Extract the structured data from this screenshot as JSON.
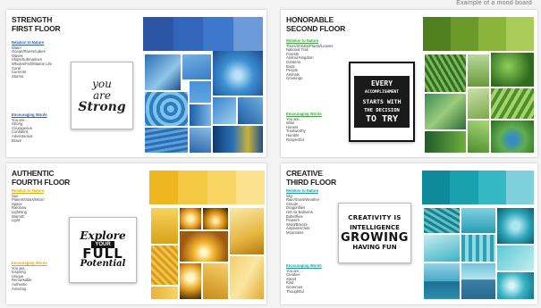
{
  "caption": "Example of a mood board",
  "panels": [
    {
      "title": "STRENGTH\nFIRST FLOOR",
      "section1_heading": "Relation to Nature",
      "section1_color": "#2b5fb8",
      "section1_items": [
        "Water",
        "Ocean/Rivers/Lakes",
        "Waves",
        "Ships/Submarines",
        "Whales/Fish/Marine Life",
        "Coral",
        "Currents",
        "Storms"
      ],
      "section2_heading": "Encouraging Words",
      "section2_color": "#2b5fb8",
      "section2_items": [
        "You are...",
        "Strong",
        "Courageous",
        "Confident",
        "Adventurous",
        "Brave"
      ],
      "quote_lines": [
        "you",
        "are",
        "Strong"
      ],
      "palette": [
        "#2c55a6",
        "#3366bb",
        "#3e78cc",
        "#6c9ad8"
      ]
    },
    {
      "title": "HONORABLE\nSECOND FLOOR",
      "section1_heading": "Relation to Nature",
      "section1_color": "#3fa83f",
      "section1_items": [
        "Trees/Shrubs/Plants/Leaves",
        "National Trail",
        "Forests",
        "Animal Kingdom",
        "Gardens",
        "Birds",
        "People",
        "Animals",
        "Greetings"
      ],
      "section2_heading": "Encouraging Words",
      "section2_color": "#3fa83f",
      "section2_items": [
        "You are...",
        "Wise",
        "Honest",
        "Trustworthy",
        "Humble",
        "Respectful"
      ],
      "quote_lines": [
        "EVERY",
        "ACCOMPLISHMENT",
        "STARTS WITH",
        "THE DECISION",
        "TO TRY"
      ],
      "palette": [
        "#4f7f1f",
        "#6b9a2a",
        "#8ab43a",
        "#a9cc58"
      ]
    },
    {
      "title": "AUTHENTIC\nFOURTH FLOOR",
      "section1_heading": "Relation to Nature",
      "section1_color": "#e0a800",
      "section1_items": [
        "Sun",
        "Planets/Stars/Moon",
        "Space",
        "Rainbow",
        "Lightning",
        "Warmth",
        "Light"
      ],
      "section2_heading": "Encouraging Words",
      "section2_color": "#e0a800",
      "section2_items": [
        "You are...",
        "Inspiring",
        "Unique",
        "Remarkable",
        "Authentic",
        "Amazing"
      ],
      "quote_lines": [
        "Explore",
        "YOUR",
        "FULL",
        "Potential"
      ],
      "palette": [
        "#efb71f",
        "#f5c842",
        "#f8d462",
        "#fae28f"
      ]
    },
    {
      "title": "CREATIVE\nTHIRD FLOOR",
      "section1_heading": "Relation to Nature",
      "section1_color": "#1a9aa8",
      "section1_items": [
        "Sky",
        "Rain/Snow/Weather",
        "Clouds",
        "Dragonflies",
        "Hot Air Balloons",
        "Butterflies",
        "Flowers",
        "Wind/Breeze",
        "Airplanes/Jets",
        "Mountains"
      ],
      "section2_heading": "Encouraging Words",
      "section2_color": "#1a9aa8",
      "section2_items": [
        "You are...",
        "Creative",
        "Smart",
        "Kind",
        "Generous",
        "Thoughtful"
      ],
      "quote_lines": [
        "CREATIVITY IS",
        "INTELLIGENCE",
        "GROWING",
        "HAVING FUN"
      ],
      "palette": [
        "#0f8a9a",
        "#1aa1b0",
        "#35b7c4",
        "#7dd0dc"
      ]
    }
  ]
}
